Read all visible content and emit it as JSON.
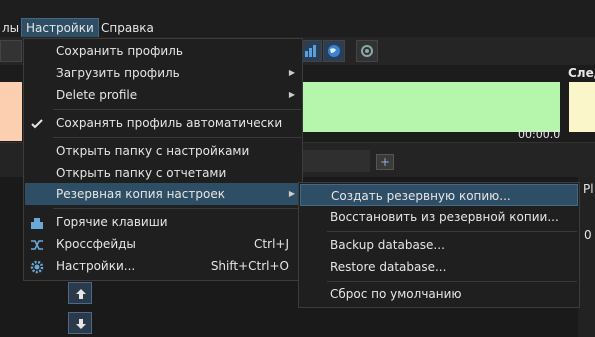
{
  "menubar": {
    "items": [
      {
        "label": "лы"
      },
      {
        "label": "Настройки"
      },
      {
        "label": "Справка"
      }
    ]
  },
  "background": {
    "next_label": "След",
    "time": "00:00.0",
    "pl_label": "Pl",
    "zero_label": "0"
  },
  "settings_menu": {
    "items": [
      {
        "label": "Сохранить профиль",
        "shortcut": "",
        "submenu": false
      },
      {
        "label": "Загрузить профиль",
        "shortcut": "",
        "submenu": true
      },
      {
        "label": "Delete profile",
        "shortcut": "",
        "submenu": true
      },
      {
        "label": "Сохранять профиль автоматически",
        "shortcut": "",
        "submenu": false,
        "checked": true
      },
      {
        "label": "Открыть папку с настройками",
        "shortcut": "",
        "submenu": false
      },
      {
        "label": "Открыть папку с отчетами",
        "shortcut": "",
        "submenu": false
      },
      {
        "label": "Резервная копия настроек",
        "shortcut": "",
        "submenu": true,
        "highlighted": true
      },
      {
        "label": "Горячие клавиши",
        "shortcut": "",
        "submenu": false,
        "icon": "hotkeys-icon"
      },
      {
        "label": "Кроссфейды",
        "shortcut": "Ctrl+J",
        "submenu": false,
        "icon": "crossfade-icon"
      },
      {
        "label": "Настройки...",
        "shortcut": "Shift+Ctrl+O",
        "submenu": false,
        "icon": "gear-icon"
      }
    ]
  },
  "backup_submenu": {
    "items": [
      {
        "label": "Создать резервную копию...",
        "highlighted": true
      },
      {
        "label": "Восстановить из резервной копии..."
      },
      {
        "label": "Backup database..."
      },
      {
        "label": "Restore database..."
      },
      {
        "label": "Сброс по умолчанию"
      }
    ]
  },
  "colors": {
    "highlight": "#2e4e65",
    "green_panel": "#b5f5ac",
    "peach_panel": "#fbcfb0",
    "yellow_panel": "#fbf6c9"
  }
}
